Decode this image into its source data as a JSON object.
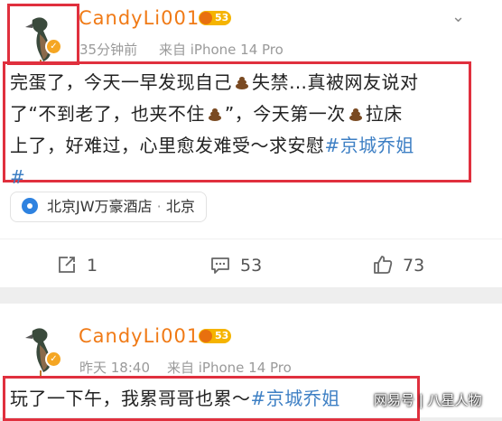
{
  "post1": {
    "username": "CandyLi001",
    "level": "53",
    "time": "35分钟前",
    "source": "来自 iPhone 14 Pro",
    "line1_a": "完蛋了，今天一早发现自己",
    "line1_b": "失禁…真被网友说对",
    "line2_a": "了“不到老了，也夹不住",
    "line2_b": "”，今天第一次",
    "line2_c": "拉床",
    "line3_a": "上了，好难过，心里愈发难受～求安慰",
    "line3_tag": "#京城乔姐",
    "line4_tag": "#",
    "location_name": "北京JW万豪酒店",
    "location_sep": " · ",
    "location_city": "北京",
    "reposts": "1",
    "comments": "53",
    "likes": "73"
  },
  "post2": {
    "username": "CandyLi001",
    "level": "53",
    "time": "昨天 18:40",
    "source": "来自 iPhone 14 Pro",
    "line1_a": "玩了一下午，我累哥哥也累～",
    "line1_tag": "#京城乔姐"
  },
  "watermark": "网易号 | 八星人物",
  "icons": {
    "more": "chevron-down-icon",
    "repost": "repost-icon",
    "comment": "comment-icon",
    "like": "thumbs-up-icon",
    "location": "location-pin-icon",
    "verified": "verified-badge-icon"
  },
  "colors": {
    "username": "#f07a16",
    "topic": "#3d7fc4",
    "highlight_box": "#e0303e"
  }
}
